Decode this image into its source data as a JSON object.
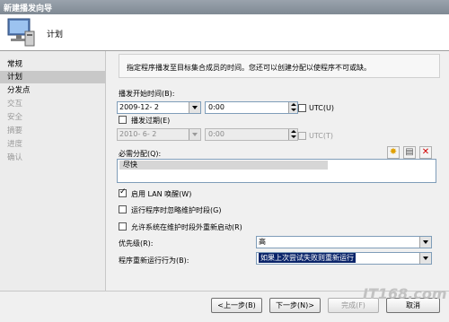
{
  "window": {
    "title": "新建播发向导"
  },
  "header": {
    "page_title": "计划"
  },
  "sidebar": {
    "items": [
      {
        "label": "常规",
        "state": "normal"
      },
      {
        "label": "计划",
        "state": "selected"
      },
      {
        "label": "分发点",
        "state": "normal"
      },
      {
        "label": "交互",
        "state": "disabled"
      },
      {
        "label": "安全",
        "state": "disabled"
      },
      {
        "label": "摘要",
        "state": "disabled"
      },
      {
        "label": "进度",
        "state": "disabled"
      },
      {
        "label": "确认",
        "state": "disabled"
      }
    ]
  },
  "main": {
    "description": "指定程序播发至目标集合成员的时间。您还可以创建分配以使程序不可或缺。",
    "start_time": {
      "label": "播发开始时间(B):",
      "date": "2009-12- 2",
      "time": "0:00",
      "utc_label": "UTC(U)",
      "utc_checked": false
    },
    "expire": {
      "label": "播发过期(E)",
      "checked": false,
      "date": "2010- 6- 2",
      "time": "0:00",
      "utc_label": "UTC(T)",
      "utc_checked": false
    },
    "assignments": {
      "label": "必需分配(Q):",
      "items": [
        "尽快"
      ]
    },
    "options": {
      "wake_on_lan": {
        "label": "启用 LAN 唤醒(W)",
        "checked": true
      },
      "ignore_maintenance": {
        "label": "运行程序时忽略维护时段(G)",
        "checked": false
      },
      "allow_restart": {
        "label": "允许系统在维护时段外重新启动(R)",
        "checked": false
      }
    },
    "priority": {
      "label": "优先级(R):",
      "value": "高"
    },
    "rerun": {
      "label": "程序重新运行行为(B):",
      "value": "如果上次尝试失败则重新运行"
    }
  },
  "footer": {
    "back_label": "<上一步(B)",
    "next_label": "下一步(N)>",
    "finish_label": "完成(F)",
    "cancel_label": "取消"
  },
  "watermark": "IT168.com",
  "colors": {
    "selection_blue": "#0a246a",
    "title_gray": "#8a939d"
  }
}
